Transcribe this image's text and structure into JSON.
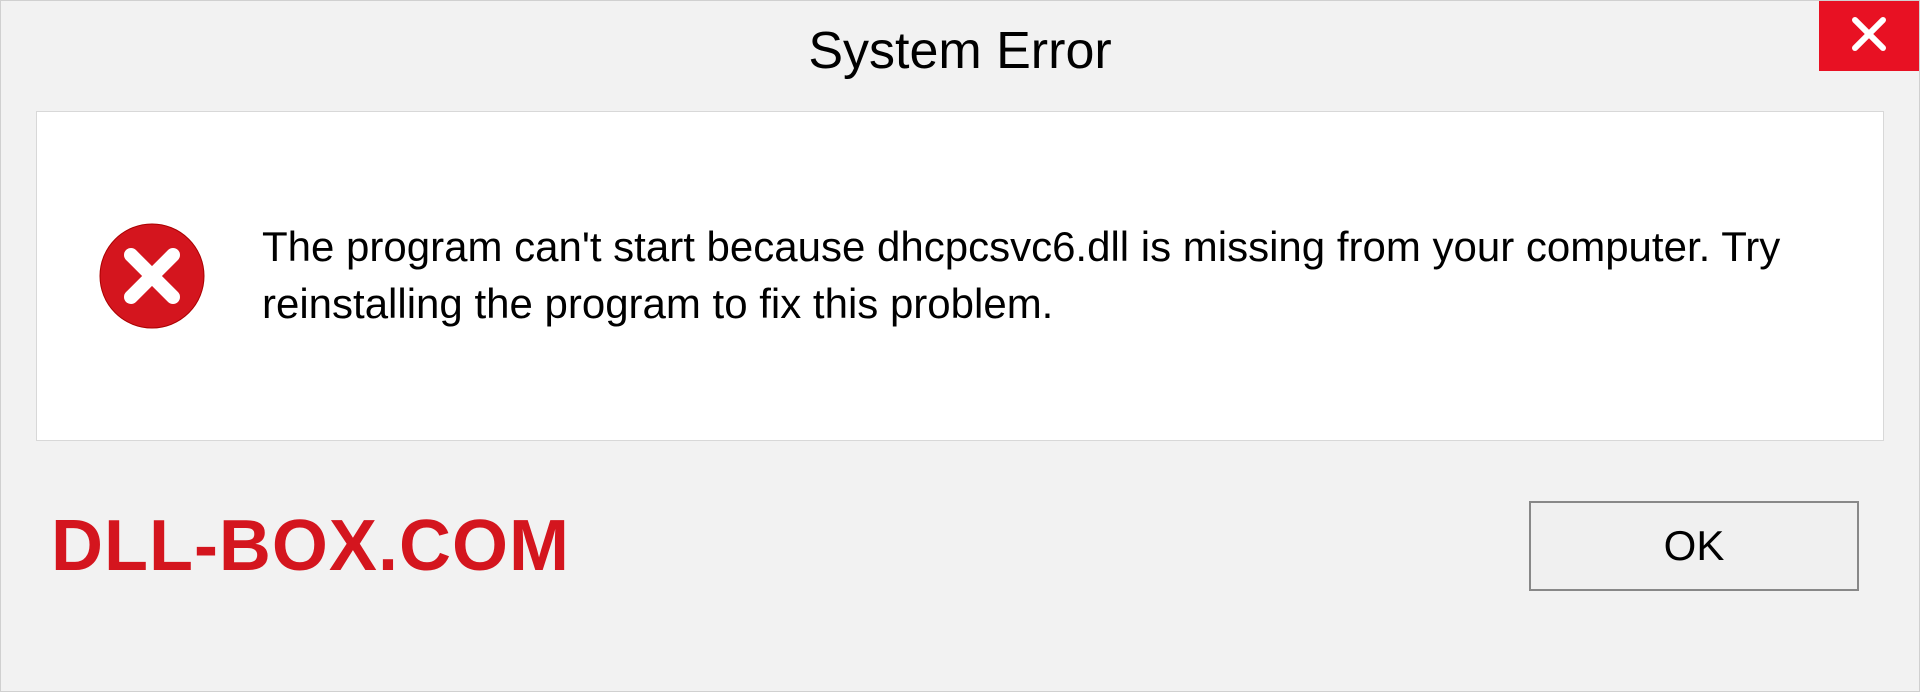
{
  "titlebar": {
    "title": "System Error"
  },
  "content": {
    "message": "The program can't start because dhcpcsvc6.dll is missing from your computer. Try reinstalling the program to fix this problem."
  },
  "footer": {
    "watermark": "DLL-BOX.COM",
    "ok_label": "OK"
  }
}
